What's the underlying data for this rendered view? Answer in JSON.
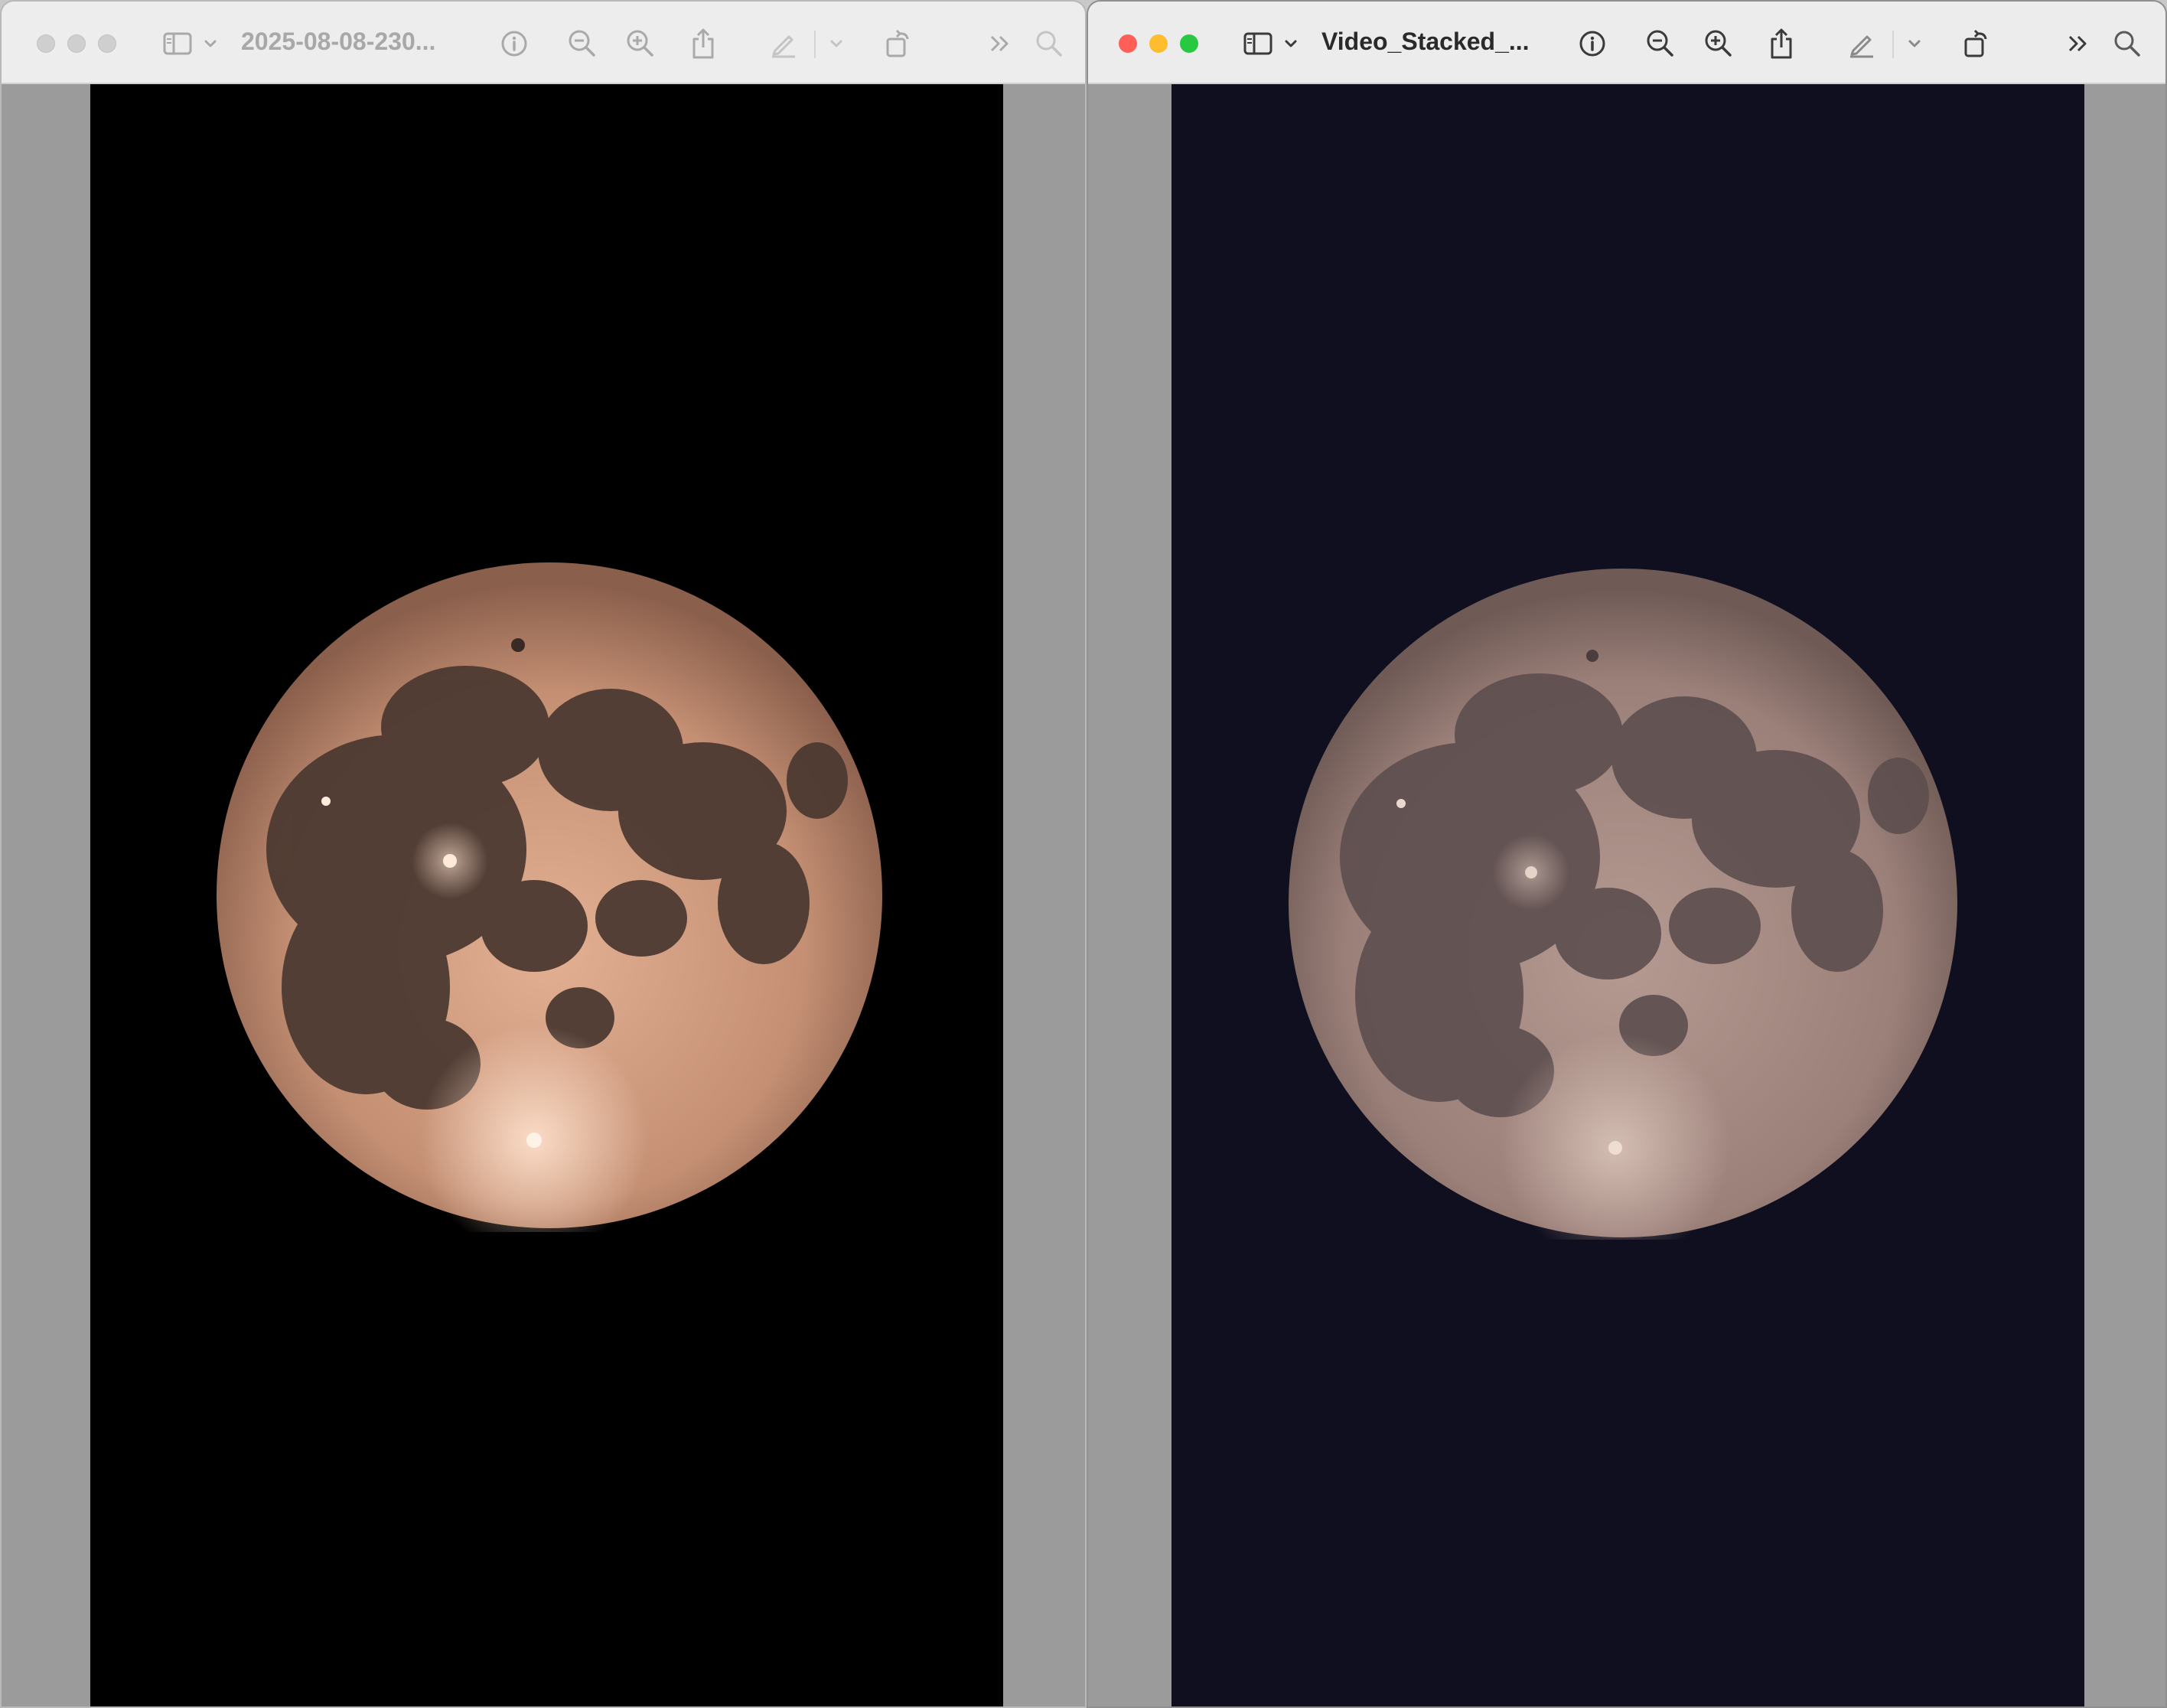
{
  "left_window": {
    "title": "2025-08-08-230...",
    "state": "inactive",
    "background_color": "#000000",
    "icons": [
      "sidebar-icon",
      "chevron-down-icon",
      "info-icon",
      "zoom-out-icon",
      "zoom-in-icon",
      "share-icon",
      "markup-pen-icon",
      "chevron-down-icon",
      "rotate-icon",
      "more-chevrons-icon",
      "search-icon"
    ]
  },
  "right_window": {
    "title": "Video_Stacked_...",
    "state": "active",
    "background_color": "#100f1f",
    "traffic_light_colors": [
      "#fe5f57",
      "#febc2e",
      "#28c840"
    ],
    "icons": [
      "sidebar-icon",
      "chevron-down-icon",
      "info-icon",
      "zoom-out-icon",
      "zoom-in-icon",
      "share-icon",
      "markup-pen-icon",
      "chevron-down-icon",
      "rotate-icon",
      "more-chevrons-icon",
      "search-icon"
    ]
  }
}
